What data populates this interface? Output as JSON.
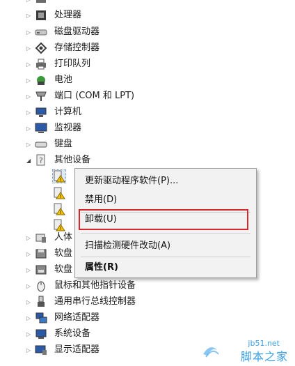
{
  "tree": {
    "top_partial": "",
    "items": [
      {
        "label": "处理器",
        "icon": "cpu-icon",
        "expander": "▷"
      },
      {
        "label": "磁盘驱动器",
        "icon": "disk-drive-icon",
        "expander": "▷"
      },
      {
        "label": "存储控制器",
        "icon": "storage-controller-icon",
        "expander": "▷"
      },
      {
        "label": "打印队列",
        "icon": "printer-icon",
        "expander": "▷"
      },
      {
        "label": "电池",
        "icon": "battery-icon",
        "expander": "▷"
      },
      {
        "label": "端口 (COM 和 LPT)",
        "icon": "port-icon",
        "expander": "▷"
      },
      {
        "label": "计算机",
        "icon": "computer-icon",
        "expander": "▷"
      },
      {
        "label": "监视器",
        "icon": "monitor-icon",
        "expander": "▷"
      },
      {
        "label": "键盘",
        "icon": "keyboard-icon",
        "expander": "▷"
      },
      {
        "label": "其他设备",
        "icon": "other-devices-icon",
        "expander": "◢"
      }
    ],
    "children": [
      {
        "label": "",
        "icon": "unknown-device-warning-icon"
      },
      {
        "label": "",
        "icon": "unknown-device-warning-icon"
      },
      {
        "label": "",
        "icon": "unknown-device-warning-icon"
      },
      {
        "label": "",
        "icon": "unknown-device-warning-icon"
      }
    ],
    "items_after": [
      {
        "label": "人体",
        "icon": "hid-icon",
        "expander": "▷"
      },
      {
        "label": "软盘",
        "icon": "floppy-icon",
        "expander": "▷"
      },
      {
        "label": "软盘",
        "icon": "floppy-controller-icon",
        "expander": "▷"
      },
      {
        "label": "鼠标和其他指针设备",
        "icon": "mouse-icon",
        "expander": "▷"
      },
      {
        "label": "通用串行总线控制器",
        "icon": "usb-icon",
        "expander": "▷"
      },
      {
        "label": "网络适配器",
        "icon": "network-adapter-icon",
        "expander": "▷"
      },
      {
        "label": "系统设备",
        "icon": "system-device-icon",
        "expander": "▷"
      },
      {
        "label": "显示适配器",
        "icon": "display-adapter-icon",
        "expander": "▷"
      }
    ]
  },
  "context_menu": {
    "update_driver": "更新驱动程序软件(P)...",
    "disable": "禁用(D)",
    "uninstall": "卸载(U)",
    "scan": "扫描检测硬件改动(A)",
    "properties": "属性(R)"
  },
  "watermark": {
    "site": "jb51.net",
    "name": "脚本之家"
  },
  "colors": {
    "highlight_box": "#d8282a",
    "watermark": "#3aa0e8",
    "menu_bg": "#f2f2f2"
  }
}
